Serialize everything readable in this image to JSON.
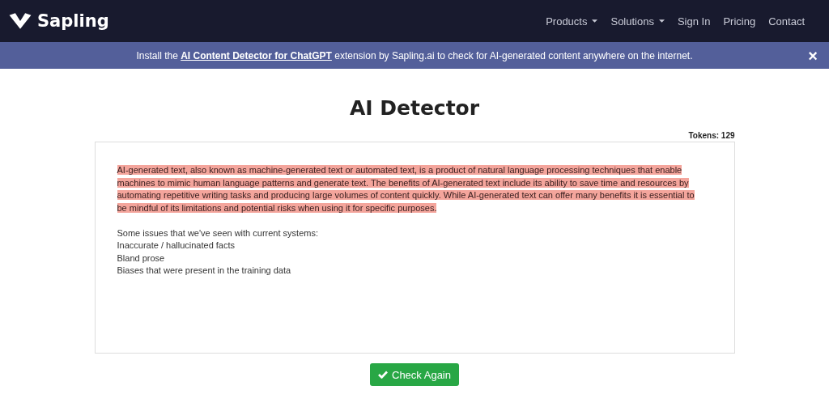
{
  "brand": {
    "name": "Sapling"
  },
  "nav": [
    {
      "label": "Products",
      "kind": "dropdown"
    },
    {
      "label": "Solutions",
      "kind": "dropdown"
    },
    {
      "label": "Sign In",
      "kind": "link"
    },
    {
      "label": "Pricing",
      "kind": "link"
    },
    {
      "label": "Contact",
      "kind": "link"
    }
  ],
  "banner": {
    "before": "Install the",
    "link": "AI Content Detector for ChatGPT",
    "after": "extension by Sapling.ai to check for AI-generated content anywhere on the internet.",
    "close": "×"
  },
  "title": "AI Detector",
  "tokens": "Tokens: 129",
  "editor": {
    "blocks": [
      {
        "text": "AI-generated text, also known as machine-generated text or automated text, is a product of natural language processing techniques that enable",
        "highlighted": true
      },
      {
        "text": "machines to mimic human language patterns and generate text. The benefits of AI-generated text include its ability to save time and resources by",
        "highlighted": true
      },
      {
        "text": "automating repetitive writing tasks and producing large volumes of content quickly. While AI-generated text can offer many benefits it is essential to",
        "highlighted": true
      },
      {
        "text": "be mindful of its limitations and potential risks when using it for specific purposes.",
        "highlighted": true
      },
      {
        "text": "Some issues that we've seen with current systems:",
        "highlighted": false
      },
      {
        "text": "Inaccurate / hallucinated facts",
        "highlighted": false
      },
      {
        "text": "Bland prose",
        "highlighted": false
      },
      {
        "text": "Biases that were present in the training data",
        "highlighted": false
      }
    ]
  },
  "button": {
    "label": "Check Again"
  }
}
